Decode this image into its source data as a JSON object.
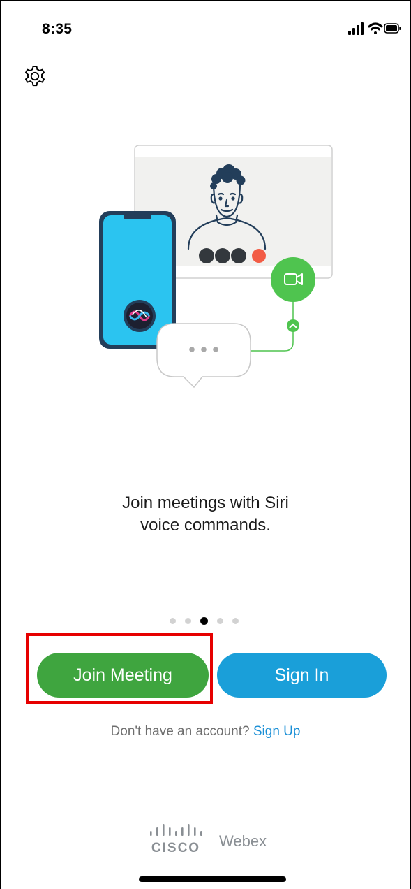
{
  "status_bar": {
    "time": "8:35"
  },
  "icons": {
    "settings": "gear-icon",
    "signal": "cellular-signal-icon",
    "wifi": "wifi-icon",
    "battery": "battery-icon",
    "siri": "siri-icon",
    "video": "video-camera-icon",
    "cisco": "cisco-logo-icon"
  },
  "onboarding": {
    "tagline_line1": "Join meetings with Siri",
    "tagline_line2": "voice commands.",
    "pager": {
      "total": 5,
      "active_index": 2
    }
  },
  "actions": {
    "join_meeting_label": "Join Meeting",
    "sign_in_label": "Sign In"
  },
  "signup": {
    "prompt": "Don't have an account?",
    "link": "Sign Up"
  },
  "brand": {
    "logo_word": "CISCO",
    "product": "Webex"
  },
  "colors": {
    "join_button": "#3fa53f",
    "sign_in_button": "#1a9fd9",
    "link": "#1a8fd6",
    "highlight_box": "#e60000",
    "phone_screen": "#2bc4f0",
    "video_badge": "#4fc44f"
  }
}
